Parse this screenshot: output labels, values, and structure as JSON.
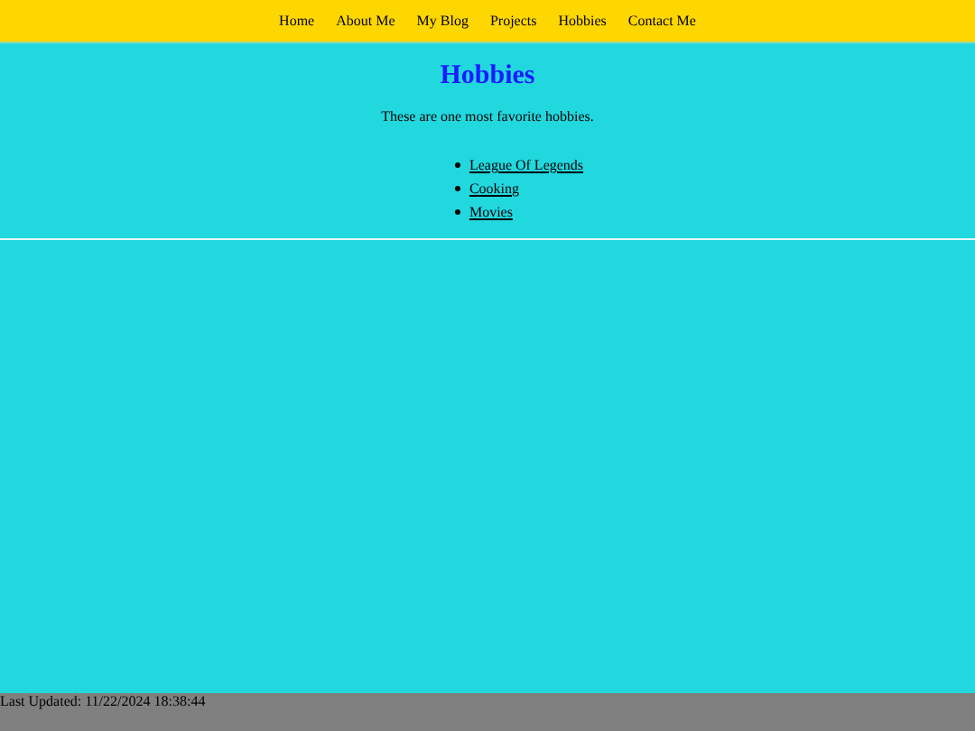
{
  "nav": {
    "links": [
      "Home",
      "About Me",
      "My Blog",
      "Projects",
      "Hobbies",
      "Contact Me"
    ]
  },
  "heading": "Hobbies",
  "intro": "These are one most favorite hobbies.",
  "hobbies": [
    "League Of Legends",
    "Cooking",
    "Movies"
  ],
  "footer": {
    "text": "Last Updated: 11/22/2024 18:38:44"
  }
}
